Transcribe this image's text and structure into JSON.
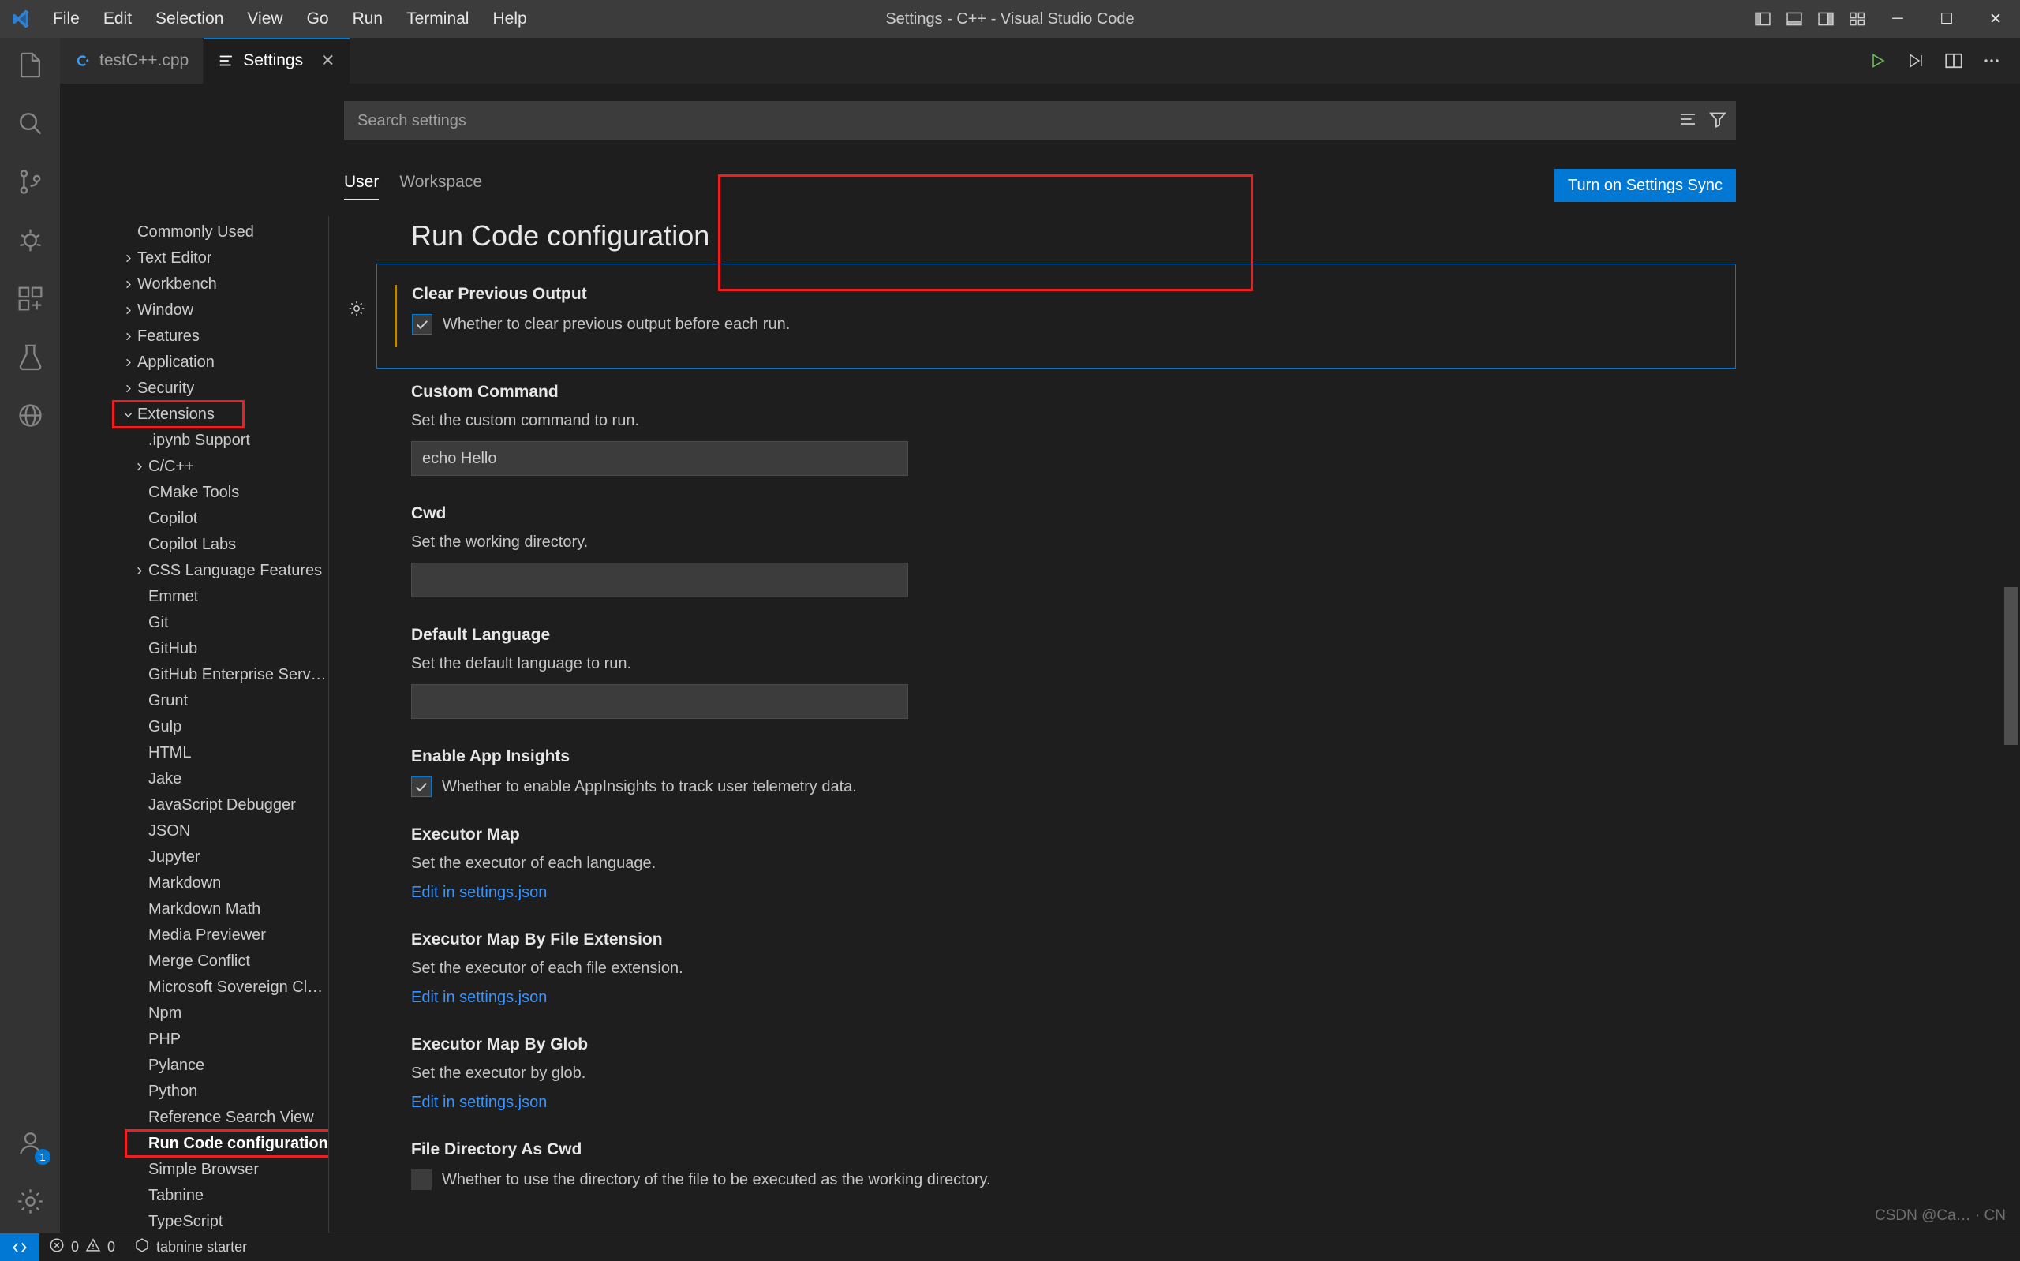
{
  "window": {
    "title": "Settings - C++ - Visual Studio Code",
    "logo": "vscode-logo"
  },
  "menubar": {
    "items": [
      {
        "label": "File"
      },
      {
        "label": "Edit"
      },
      {
        "label": "Selection"
      },
      {
        "label": "View"
      },
      {
        "label": "Go"
      },
      {
        "label": "Run"
      },
      {
        "label": "Terminal"
      },
      {
        "label": "Help"
      }
    ]
  },
  "titlebar_actions": {
    "toggle_primary_sidebar": "layout-sidebar-left-icon",
    "toggle_panel": "layout-panel-icon",
    "toggle_secondary_sidebar": "layout-sidebar-right-icon",
    "customize_layout": "layout-customize-icon",
    "minimize": "─",
    "maximize": "☐",
    "close": "✕"
  },
  "activitybar": {
    "items": [
      {
        "name": "explorer",
        "icon": "files-icon",
        "active": false
      },
      {
        "name": "search",
        "icon": "search-icon",
        "active": false
      },
      {
        "name": "source-control",
        "icon": "source-control-icon",
        "active": false
      },
      {
        "name": "run-and-debug",
        "icon": "debug-icon",
        "active": false
      },
      {
        "name": "extensions",
        "icon": "extensions-icon",
        "active": false
      },
      {
        "name": "testing",
        "icon": "beaker-icon",
        "active": false
      },
      {
        "name": "remote-explorer",
        "icon": "remote-icon",
        "active": false
      }
    ],
    "bottom": [
      {
        "name": "accounts",
        "icon": "account-icon",
        "badge": "1"
      },
      {
        "name": "manage",
        "icon": "gear-icon",
        "badge": ""
      }
    ]
  },
  "tabs": [
    {
      "label": "testC++.cpp",
      "icon": "cpp-file-icon",
      "active": false,
      "close": "✕"
    },
    {
      "label": "Settings",
      "icon": "settings-tab-icon",
      "active": true,
      "close": "✕"
    }
  ],
  "editor_actions": {
    "run": "run-icon",
    "run_debug": "run-debug-icon",
    "split_editor": "split-editor-icon",
    "more": "ellipsis-icon"
  },
  "settings": {
    "search": {
      "placeholder": "Search settings",
      "value": "",
      "clear_filters_icon": "clear-filters-icon",
      "filter_icon": "filter-icon"
    },
    "scope_tabs": [
      {
        "label": "User",
        "active": true
      },
      {
        "label": "Workspace",
        "active": false
      }
    ],
    "sync_button": "Turn on Settings Sync",
    "toc": [
      {
        "label": "Commonly Used",
        "arrow": "none",
        "indent": 0,
        "selected": false
      },
      {
        "label": "Text Editor",
        "arrow": "collapsed",
        "indent": 0,
        "selected": false
      },
      {
        "label": "Workbench",
        "arrow": "collapsed",
        "indent": 0,
        "selected": false
      },
      {
        "label": "Window",
        "arrow": "collapsed",
        "indent": 0,
        "selected": false
      },
      {
        "label": "Features",
        "arrow": "collapsed",
        "indent": 0,
        "selected": false
      },
      {
        "label": "Application",
        "arrow": "collapsed",
        "indent": 0,
        "selected": false
      },
      {
        "label": "Security",
        "arrow": "collapsed",
        "indent": 0,
        "selected": false
      },
      {
        "label": "Extensions",
        "arrow": "expanded",
        "indent": 0,
        "selected": false,
        "highlighted": true
      },
      {
        "label": ".ipynb Support",
        "arrow": "none",
        "indent": 1,
        "selected": false
      },
      {
        "label": "C/C++",
        "arrow": "collapsed",
        "indent": 1,
        "selected": false
      },
      {
        "label": "CMake Tools",
        "arrow": "none",
        "indent": 1,
        "selected": false
      },
      {
        "label": "Copilot",
        "arrow": "none",
        "indent": 1,
        "selected": false
      },
      {
        "label": "Copilot Labs",
        "arrow": "none",
        "indent": 1,
        "selected": false
      },
      {
        "label": "CSS Language Features",
        "arrow": "collapsed",
        "indent": 1,
        "selected": false
      },
      {
        "label": "Emmet",
        "arrow": "none",
        "indent": 1,
        "selected": false
      },
      {
        "label": "Git",
        "arrow": "none",
        "indent": 1,
        "selected": false
      },
      {
        "label": "GitHub",
        "arrow": "none",
        "indent": 1,
        "selected": false
      },
      {
        "label": "GitHub Enterprise Server Authen…",
        "arrow": "none",
        "indent": 1,
        "selected": false
      },
      {
        "label": "Grunt",
        "arrow": "none",
        "indent": 1,
        "selected": false
      },
      {
        "label": "Gulp",
        "arrow": "none",
        "indent": 1,
        "selected": false
      },
      {
        "label": "HTML",
        "arrow": "none",
        "indent": 1,
        "selected": false
      },
      {
        "label": "Jake",
        "arrow": "none",
        "indent": 1,
        "selected": false
      },
      {
        "label": "JavaScript Debugger",
        "arrow": "none",
        "indent": 1,
        "selected": false
      },
      {
        "label": "JSON",
        "arrow": "none",
        "indent": 1,
        "selected": false
      },
      {
        "label": "Jupyter",
        "arrow": "none",
        "indent": 1,
        "selected": false
      },
      {
        "label": "Markdown",
        "arrow": "none",
        "indent": 1,
        "selected": false
      },
      {
        "label": "Markdown Math",
        "arrow": "none",
        "indent": 1,
        "selected": false
      },
      {
        "label": "Media Previewer",
        "arrow": "none",
        "indent": 1,
        "selected": false
      },
      {
        "label": "Merge Conflict",
        "arrow": "none",
        "indent": 1,
        "selected": false
      },
      {
        "label": "Microsoft Sovereign Cloud",
        "arrow": "none",
        "indent": 1,
        "selected": false
      },
      {
        "label": "Npm",
        "arrow": "none",
        "indent": 1,
        "selected": false
      },
      {
        "label": "PHP",
        "arrow": "none",
        "indent": 1,
        "selected": false
      },
      {
        "label": "Pylance",
        "arrow": "none",
        "indent": 1,
        "selected": false
      },
      {
        "label": "Python",
        "arrow": "none",
        "indent": 1,
        "selected": false
      },
      {
        "label": "Reference Search View",
        "arrow": "none",
        "indent": 1,
        "selected": false
      },
      {
        "label": "Run Code configuration",
        "arrow": "none",
        "indent": 1,
        "selected": true,
        "highlighted": true
      },
      {
        "label": "Simple Browser",
        "arrow": "none",
        "indent": 1,
        "selected": false
      },
      {
        "label": "Tabnine",
        "arrow": "none",
        "indent": 1,
        "selected": false
      },
      {
        "label": "TypeScript",
        "arrow": "none",
        "indent": 1,
        "selected": false
      }
    ],
    "page_title": "Run Code configuration",
    "items": [
      {
        "id": "clear-previous-output",
        "title": "Clear Previous Output",
        "type": "checkbox",
        "checkbox_label": "Whether to clear previous output before each run.",
        "checked": true,
        "focused": true,
        "highlighted": true
      },
      {
        "id": "custom-command",
        "title": "Custom Command",
        "type": "text",
        "description": "Set the custom command to run.",
        "value": "echo Hello",
        "placeholder": ""
      },
      {
        "id": "cwd",
        "title": "Cwd",
        "type": "text",
        "description": "Set the working directory.",
        "value": "",
        "placeholder": ""
      },
      {
        "id": "default-language",
        "title": "Default Language",
        "type": "text",
        "description": "Set the default language to run.",
        "value": "",
        "placeholder": ""
      },
      {
        "id": "enable-app-insights",
        "title": "Enable App Insights",
        "type": "checkbox",
        "checkbox_label": "Whether to enable AppInsights to track user telemetry data.",
        "checked": true
      },
      {
        "id": "executor-map",
        "title": "Executor Map",
        "type": "json",
        "description": "Set the executor of each language.",
        "link": "Edit in settings.json"
      },
      {
        "id": "executor-map-by-file-extension",
        "title": "Executor Map By File Extension",
        "type": "json",
        "description": "Set the executor of each file extension.",
        "link": "Edit in settings.json"
      },
      {
        "id": "executor-map-by-glob",
        "title": "Executor Map By Glob",
        "type": "json",
        "description": "Set the executor by glob.",
        "link": "Edit in settings.json"
      },
      {
        "id": "file-directory-as-cwd",
        "title": "File Directory As Cwd",
        "type": "checkbox",
        "checkbox_label": "Whether to use the directory of the file to be executed as the working directory.",
        "checked": false
      }
    ]
  },
  "statusbar": {
    "remote_label": "",
    "errors": "0",
    "warnings": "0",
    "tabnine": "tabnine starter"
  },
  "watermark": {
    "text": "CSDN @Ca… · CN"
  },
  "colors": {
    "accent": "#0078d4",
    "highlight_box": "#f01e1e",
    "link": "#3794ff",
    "titlebar_bg": "#3c3c3c",
    "editor_bg": "#1e1e1e",
    "activitybar_bg": "#333333",
    "modified_indicator": "#b58900"
  }
}
